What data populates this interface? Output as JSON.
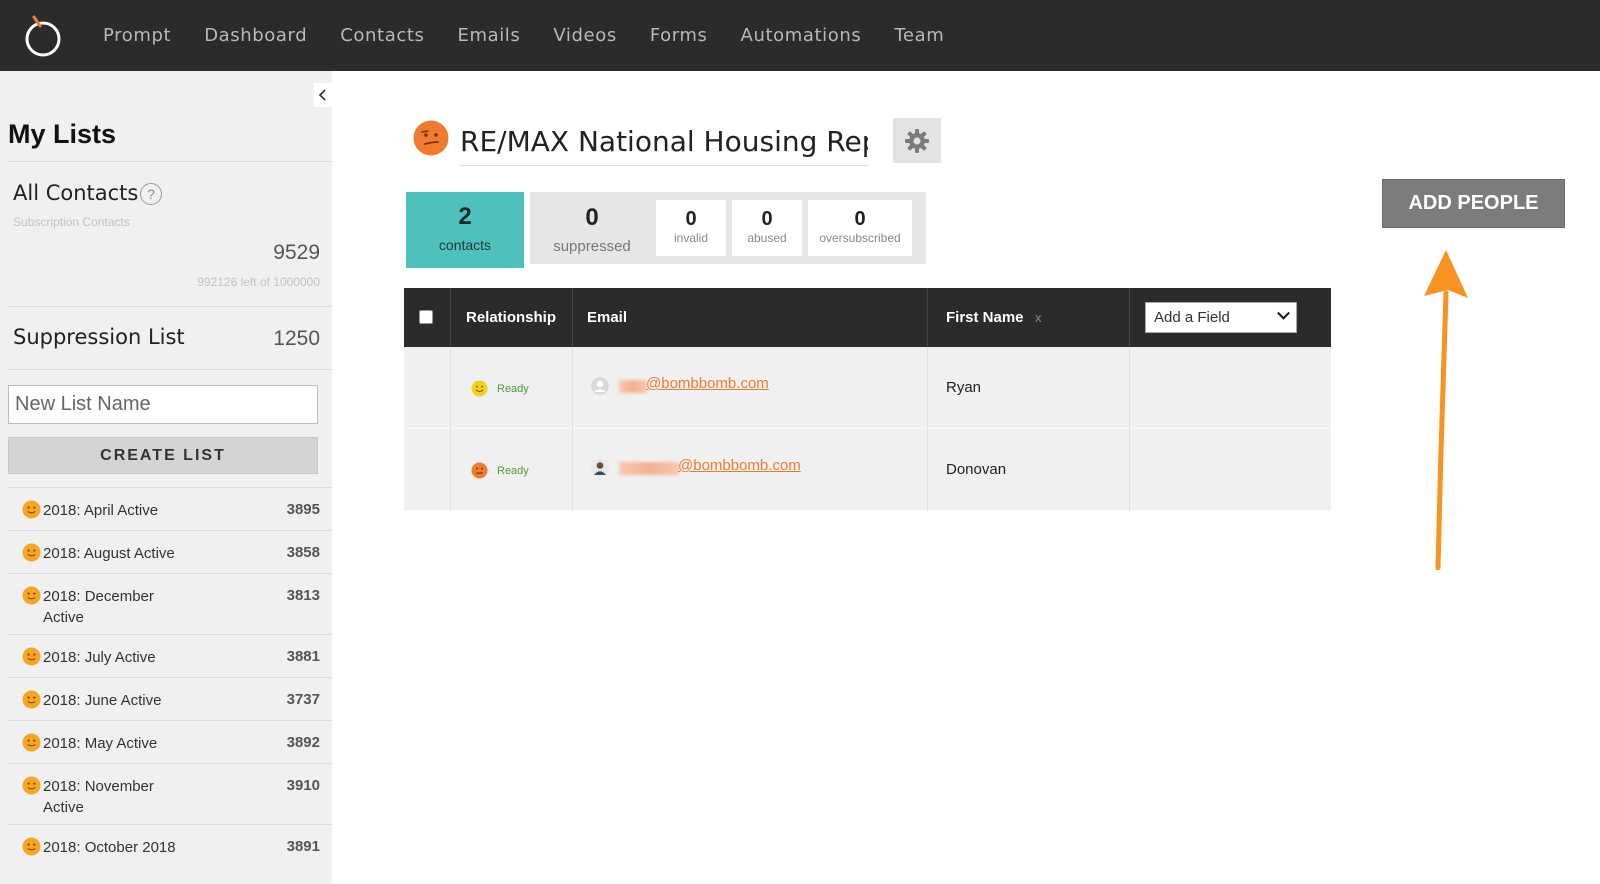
{
  "nav": {
    "items": [
      "Prompt",
      "Dashboard",
      "Contacts",
      "Emails",
      "Videos",
      "Forms",
      "Automations",
      "Team"
    ]
  },
  "sidebar": {
    "title": "My Lists",
    "all_contacts": {
      "label": "All Contacts",
      "help": "?",
      "sublabel": "Subscription Contacts",
      "count": "9529",
      "remaining": "992126 left of 1000000"
    },
    "suppression": {
      "label": "Suppression List",
      "count": "1250"
    },
    "new_list_placeholder": "New List Name",
    "create_button": "CREATE LIST",
    "lists": [
      {
        "label": "2018: April Active",
        "count": "3895"
      },
      {
        "label": "2018: August Active",
        "count": "3858"
      },
      {
        "label": "2018: December Active",
        "count": "3813"
      },
      {
        "label": "2018: July Active",
        "count": "3881"
      },
      {
        "label": "2018: June Active",
        "count": "3737"
      },
      {
        "label": "2018: May Active",
        "count": "3892"
      },
      {
        "label": "2018: November Active",
        "count": "3910"
      },
      {
        "label": "2018: October 2018",
        "count": "3891"
      }
    ]
  },
  "main": {
    "list_title": "RE/MAX National Housing Repc",
    "stats": {
      "contacts": {
        "value": "2",
        "label": "contacts"
      },
      "suppressed": {
        "value": "0",
        "label": "suppressed"
      },
      "invalid": {
        "value": "0",
        "label": "invalid"
      },
      "abused": {
        "value": "0",
        "label": "abused"
      },
      "oversubscribed": {
        "value": "0",
        "label": "oversubscribed"
      }
    },
    "add_people": "ADD PEOPLE",
    "table": {
      "headers": {
        "relationship": "Relationship",
        "email": "Email",
        "first_name": "First Name",
        "remove": "x",
        "add_field": "Add a Field"
      },
      "rows": [
        {
          "status": "Ready",
          "email": "@bombbomb.com",
          "first_name": "Ryan"
        },
        {
          "status": "Ready",
          "email": "@bombbomb.com",
          "first_name": "Donovan"
        }
      ]
    }
  },
  "colors": {
    "accent_orange": "#ef7b2e",
    "teal": "#4fc1bc",
    "nav_bg": "#2b2b2b",
    "ready_green": "#4e9a3a",
    "arrow": "#f7931e"
  }
}
